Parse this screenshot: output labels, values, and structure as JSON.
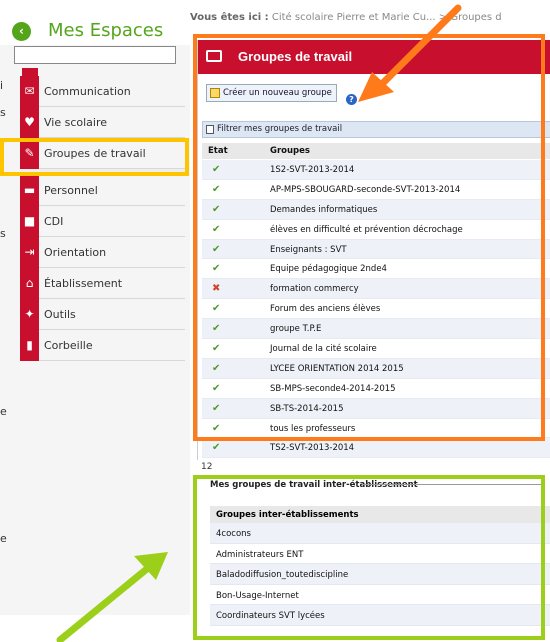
{
  "sidebar": {
    "title": "Mes Espaces",
    "items": [
      {
        "label": "Communication",
        "icon": "chat-icon"
      },
      {
        "label": "Vie scolaire",
        "icon": "heart-icon"
      },
      {
        "label": "Groupes de travail",
        "icon": "edit-icon"
      },
      {
        "label": "Personnel",
        "icon": "folder-icon"
      },
      {
        "label": "CDI",
        "icon": "book-icon"
      },
      {
        "label": "Orientation",
        "icon": "signpost-icon"
      },
      {
        "label": "Établissement",
        "icon": "home-icon"
      },
      {
        "label": "Outils",
        "icon": "wrench-icon"
      },
      {
        "label": "Corbeille",
        "icon": "trash-icon"
      }
    ],
    "fragments": [
      "i",
      "s",
      "s",
      "e",
      "e"
    ]
  },
  "breadcrumb": {
    "prefix": "Vous êtes ici :",
    "path": "Cité scolaire Pierre et Marie Cu... > Groupes d"
  },
  "main": {
    "title": "Groupes de travail",
    "create_button": "Créer un nouveau groupe",
    "filter_label": "Filtrer mes groupes de travail",
    "col_state": "Etat",
    "col_groups": "Groupes",
    "rows": [
      {
        "state": "ok",
        "name": "1S2-SVT-2013-2014"
      },
      {
        "state": "ok",
        "name": "AP-MPS-SBOUGARD-seconde-SVT-2013-2014"
      },
      {
        "state": "ok",
        "name": "Demandes informatiques"
      },
      {
        "state": "ok",
        "name": "élèves en difficulté et prévention décrochage"
      },
      {
        "state": "ok",
        "name": "Enseignants : SVT"
      },
      {
        "state": "ok",
        "name": "Equipe pédagogique 2nde4"
      },
      {
        "state": "ko",
        "name": "formation commercy"
      },
      {
        "state": "ok",
        "name": "Forum des anciens élèves"
      },
      {
        "state": "ok",
        "name": "groupe T.P.E"
      },
      {
        "state": "ok",
        "name": "Journal de la cité scolaire"
      },
      {
        "state": "ok",
        "name": "LYCEE ORIENTATION 2014 2015"
      },
      {
        "state": "ok",
        "name": "SB-MPS-seconde4-2014-2015"
      },
      {
        "state": "ok",
        "name": "SB-TS-2014-2015"
      },
      {
        "state": "ok",
        "name": "tous les professeurs"
      },
      {
        "state": "ok",
        "name": "TS2-SVT-2013-2014"
      }
    ],
    "count": "12"
  },
  "inter": {
    "title": "Mes groupes de travail inter-établissement",
    "col_header": "Groupes inter-établissements",
    "rows": [
      "4cocons",
      "Administrateurs ENT",
      "Baladodiffusion_toutediscipline",
      "Bon-Usage-Internet",
      "Coordinateurs SVT lycées"
    ]
  },
  "colors": {
    "accent_red": "#c8102e",
    "brand_green": "#55a51c",
    "highlight_orange": "#ff7a1a",
    "highlight_yellow": "#ffc400",
    "highlight_green": "#9ccf1a"
  }
}
